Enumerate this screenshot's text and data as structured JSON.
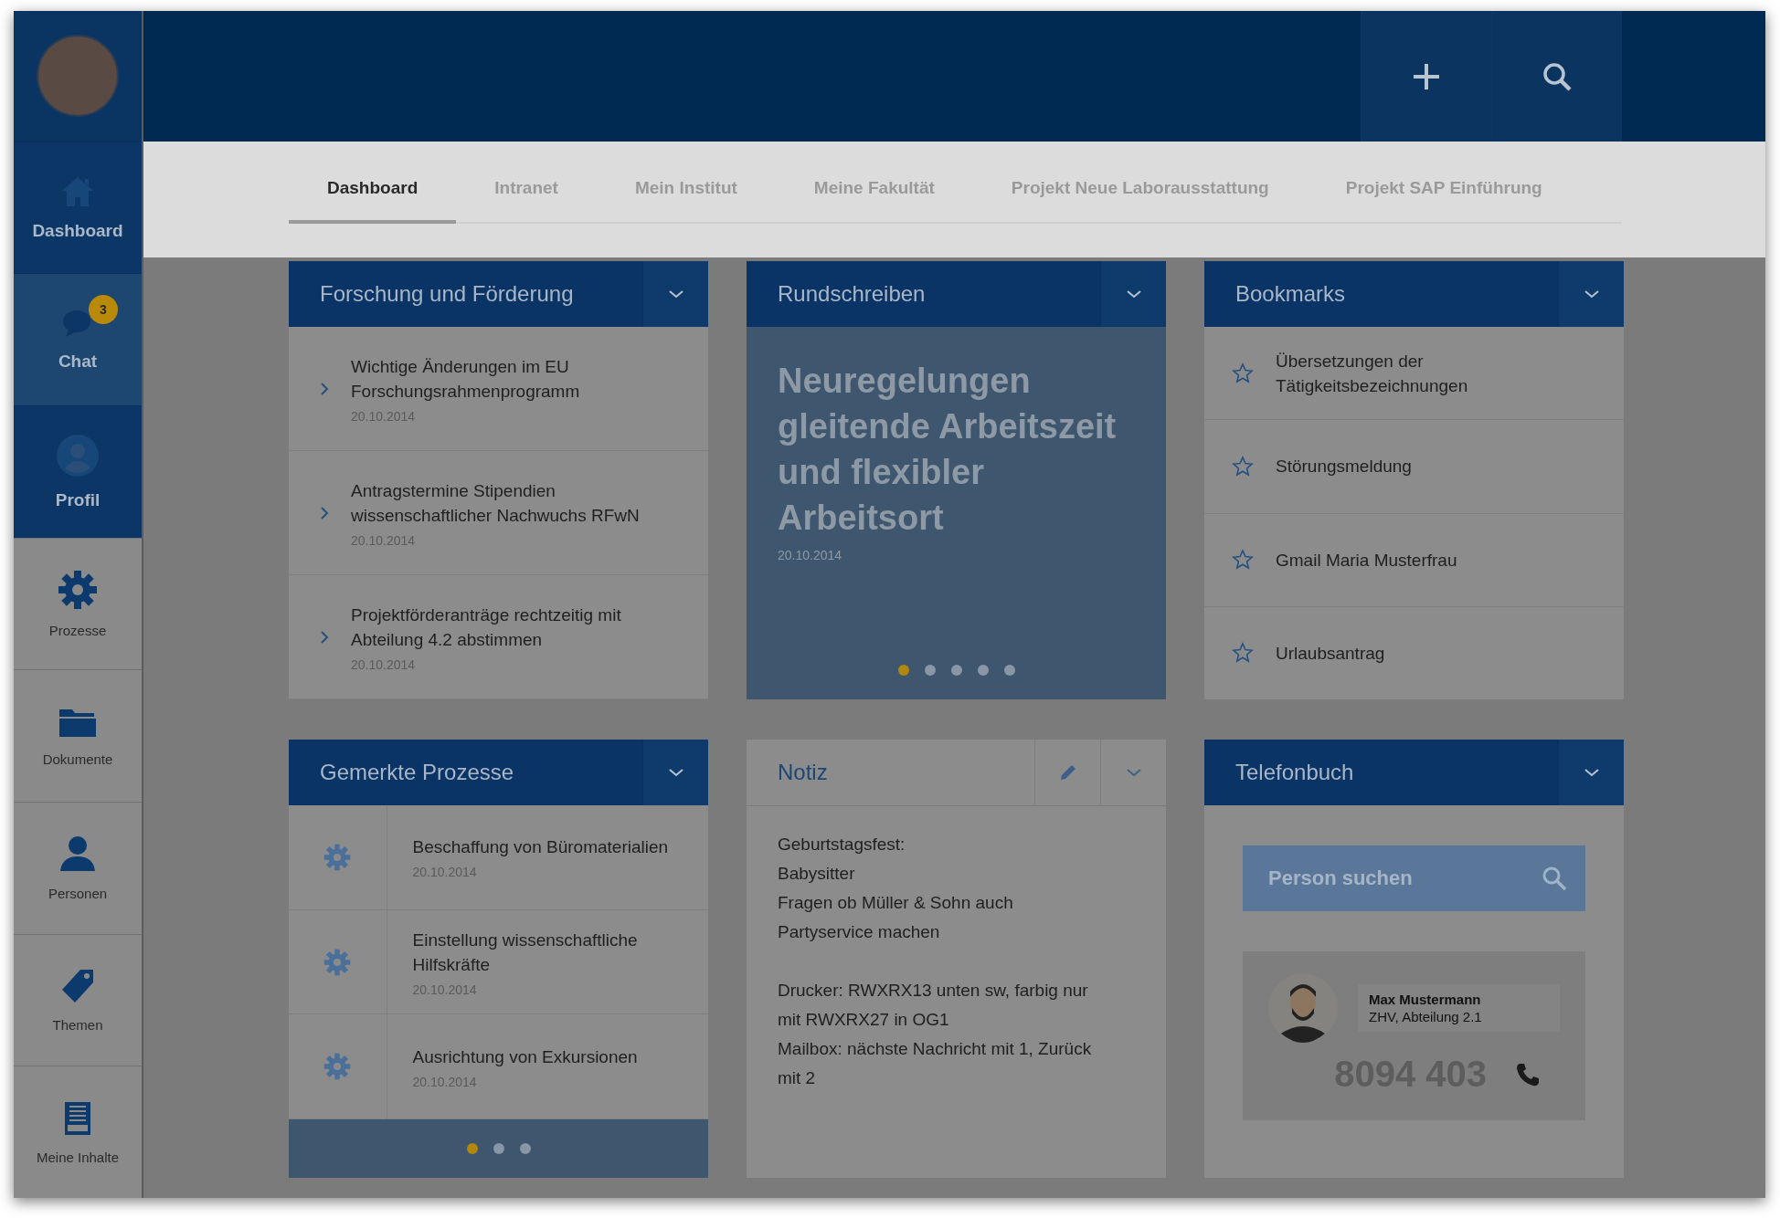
{
  "sidebar": {
    "items": [
      {
        "label": "Dashboard",
        "dimmed": false,
        "hovered": false
      },
      {
        "label": "Chat",
        "dimmed": false,
        "hovered": true,
        "badge": "3"
      },
      {
        "label": "Profil",
        "dimmed": false,
        "hovered": false
      },
      {
        "label": "Prozesse",
        "dimmed": true,
        "hovered": false
      },
      {
        "label": "Dokumente",
        "dimmed": true,
        "hovered": false
      },
      {
        "label": "Personen",
        "dimmed": true,
        "hovered": false
      },
      {
        "label": "Themen",
        "dimmed": true,
        "hovered": false
      },
      {
        "label": "Meine Inhalte",
        "dimmed": true,
        "hovered": false
      }
    ]
  },
  "tabs": [
    {
      "label": "Dashboard",
      "selected": true
    },
    {
      "label": "Intranet",
      "selected": false
    },
    {
      "label": "Mein Institut",
      "selected": false
    },
    {
      "label": "Meine Fakultät",
      "selected": false
    },
    {
      "label": "Projekt Neue Laborausstattung",
      "selected": false
    },
    {
      "label": "Projekt SAP Einführung",
      "selected": false
    }
  ],
  "panels": [
    {
      "kind": "news",
      "title": "Forschung und Förderung",
      "items": [
        {
          "text": "Wichtige Änderungen im EU Forschungsrahmenprogramm",
          "date": "20.10.2014"
        },
        {
          "text": "Antragstermine Stipendien wissenschaftlicher Nachwuchs RFwN",
          "date": "20.10.2014"
        },
        {
          "text": "Projektförderanträge rechtzeitig mit Abteilung 4.2 abstimmen",
          "date": "20.10.2014"
        }
      ]
    },
    {
      "kind": "carousel",
      "title": "Rundschreiben",
      "headline": "Neuregelungen gleitende Arbeitszeit und flexibler Arbeitsort",
      "date": "20.10.2014",
      "dots": [
        {
          "selected": true
        },
        {
          "selected": false
        },
        {
          "selected": false
        },
        {
          "selected": false
        },
        {
          "selected": false
        }
      ]
    },
    {
      "kind": "bookmarks",
      "title": "Bookmarks",
      "items": [
        {
          "text": "Übersetzungen der Tätigkeitsbezeichnungen"
        },
        {
          "text": "Störungsmeldung"
        },
        {
          "text": "Gmail Maria Musterfrau"
        },
        {
          "text": "Urlaubsantrag"
        }
      ]
    },
    {
      "kind": "processes",
      "title": "Gemerkte Prozesse",
      "items": [
        {
          "text": "Beschaffung von Büromaterialien",
          "date": "20.10.2014"
        },
        {
          "text": "Einstellung wissenschaftliche Hilfskräfte",
          "date": "20.10.2014"
        },
        {
          "text": "Ausrichtung von Exkursionen",
          "date": "20.10.2014"
        }
      ],
      "dots": [
        {
          "selected": true
        },
        {
          "selected": false
        },
        {
          "selected": false
        }
      ]
    },
    {
      "kind": "note",
      "title": "Notiz",
      "paragraphs": [
        [
          "Geburtstagsfest:",
          "Babysitter",
          "Fragen ob Müller & Sohn auch",
          "Partyservice machen"
        ],
        [
          "Drucker: RWXRX13 unten sw, farbig nur",
          "mit RWXRX27 in OG1",
          "Mailbox: nächste Nachricht mit 1, Zurück",
          "mit 2"
        ]
      ]
    },
    {
      "kind": "phonebook",
      "title": "Telefonbuch",
      "search": {
        "placeholder": "Person suchen"
      },
      "contact": {
        "name": "Max Mustermann",
        "department": "ZHV, Abteilung 2.1",
        "phone": "8094 403"
      }
    }
  ]
}
